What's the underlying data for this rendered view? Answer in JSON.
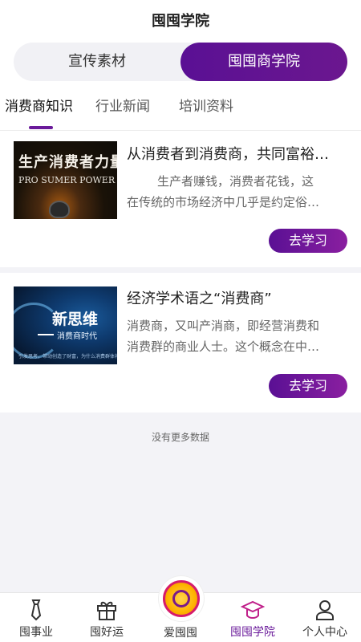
{
  "header": {
    "title": "囤囤学院"
  },
  "segment": {
    "left_label": "宣传素材",
    "right_label": "囤囤商学院",
    "active": "囤囤商学院"
  },
  "tabs": [
    {
      "label": "消费商知识",
      "active": true
    },
    {
      "label": "行业新闻",
      "active": false
    },
    {
      "label": "培训资料",
      "active": false
    }
  ],
  "articles": [
    {
      "title": "从消费者到消费商，共同富裕…",
      "desc_lines": [
        "生产者赚钱，消费者花钱，这",
        "在传统的市场经济中几乎是约定俗…"
      ],
      "button": "去学习",
      "thumb_text": {
        "main": "生产消费者力量",
        "sub": "PRO SUMER POWER"
      }
    },
    {
      "title": "经济学术语之“消费商”",
      "desc_lines": [
        "消费商，又叫产消商，即经营消费和",
        "消费群的商业人士。这个概念在中…"
      ],
      "button": "去学习",
      "thumb_text": {
        "main": "新思维",
        "sub": "消费商时代",
        "tiny": "引发思考，带动创造了财富，为什么消费群体将被颠覆"
      }
    }
  ],
  "footer_note": "没有更多数据",
  "bottom_nav": [
    {
      "label": "囤事业",
      "icon": "tie-icon",
      "active": false
    },
    {
      "label": "囤好运",
      "icon": "gift-icon",
      "active": false
    },
    {
      "label": "爱囤囤",
      "icon": "coin-logo-icon",
      "active": false
    },
    {
      "label": "囤囤学院",
      "icon": "graduation-cap-icon",
      "active": true
    },
    {
      "label": "个人中心",
      "icon": "person-icon",
      "active": false
    }
  ],
  "colors": {
    "accent": "#6a1a9a",
    "background": "#f3f3f7",
    "card": "#ffffff"
  }
}
